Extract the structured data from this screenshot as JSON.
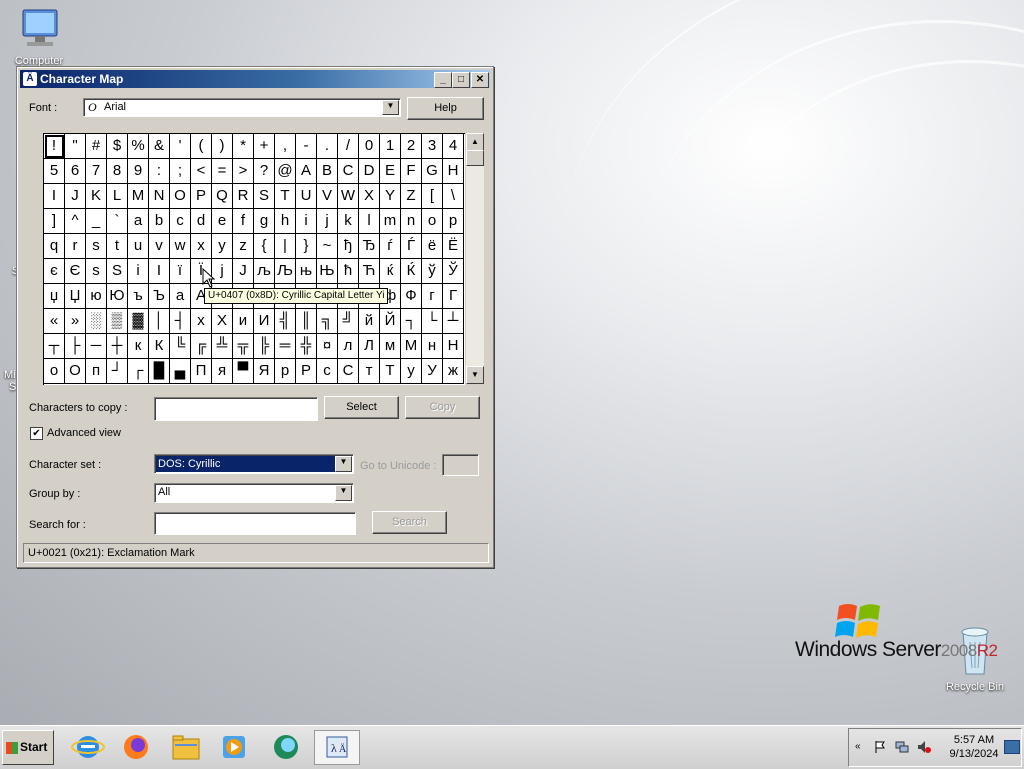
{
  "desktop": {
    "icons": [
      {
        "label": "Computer"
      },
      {
        "label": "Recycle Bin"
      }
    ],
    "edge_fragments": [
      "Mi",
      "S",
      "S"
    ],
    "logo": {
      "brand": "Windows Server",
      "version": "2008",
      "edition": "R2"
    }
  },
  "window": {
    "title": "Character Map",
    "font_label": "Font :",
    "font_value": "Arial",
    "help_label": "Help",
    "grid_rows": [
      [
        "!",
        "\"",
        "#",
        "$",
        "%",
        "&",
        "'",
        "(",
        ")",
        "*",
        "+",
        ",",
        "-",
        ".",
        "/",
        "0",
        "1",
        "2",
        "3",
        "4"
      ],
      [
        "5",
        "6",
        "7",
        "8",
        "9",
        ":",
        ";",
        "<",
        "=",
        ">",
        "?",
        "@",
        "A",
        "B",
        "C",
        "D",
        "E",
        "F",
        "G",
        "H"
      ],
      [
        "I",
        "J",
        "K",
        "L",
        "M",
        "N",
        "O",
        "P",
        "Q",
        "R",
        "S",
        "T",
        "U",
        "V",
        "W",
        "X",
        "Y",
        "Z",
        "[",
        "\\"
      ],
      [
        "]",
        "^",
        "_",
        "`",
        "a",
        "b",
        "c",
        "d",
        "e",
        "f",
        "g",
        "h",
        "i",
        "j",
        "k",
        "l",
        "m",
        "n",
        "o",
        "p"
      ],
      [
        "q",
        "r",
        "s",
        "t",
        "u",
        "v",
        "w",
        "x",
        "y",
        "z",
        "{",
        "|",
        "}",
        "~",
        "ђ",
        "Ђ",
        "ѓ",
        "Ѓ",
        "ё",
        "Ё"
      ],
      [
        "є",
        "Є",
        "ѕ",
        "Ѕ",
        "і",
        "І",
        "ї",
        "Ї",
        "ј",
        "Ј",
        "љ",
        "Љ",
        "њ",
        "Њ",
        "ћ",
        "Ћ",
        "ќ",
        "Ќ",
        "ў",
        "Ў"
      ],
      [
        "џ",
        "Џ",
        "ю",
        "Ю",
        "ъ",
        "Ъ",
        "а",
        "А",
        "б",
        "Б",
        "ц",
        "Ц",
        "д",
        "Д",
        "е",
        "Е",
        "ф",
        "Ф",
        "г",
        "Г"
      ],
      [
        "«",
        "»",
        "░",
        "▒",
        "▓",
        "│",
        "┤",
        "х",
        "Х",
        "и",
        "И",
        "╣",
        "║",
        "╗",
        "╝",
        "й",
        "Й",
        "┐",
        "└",
        "┴"
      ],
      [
        "┬",
        "├",
        "─",
        "┼",
        "к",
        "К",
        "╚",
        "╔",
        "╩",
        "╦",
        "╠",
        "═",
        "╬",
        "¤",
        "л",
        "Л",
        "м",
        "М",
        "н",
        "Н"
      ],
      [
        "о",
        "О",
        "п",
        "┘",
        "┌",
        "█",
        "▄",
        "П",
        "я",
        "▀",
        "Я",
        "р",
        "Р",
        "с",
        "С",
        "т",
        "Т",
        "у",
        "У",
        "ж"
      ]
    ],
    "selected_char": "!",
    "tooltip": "U+0407 (0x8D): Cyrillic Capital Letter Yi",
    "chars_to_copy_label": "Characters to copy :",
    "chars_to_copy_value": "",
    "select_label": "Select",
    "copy_label": "Copy",
    "advanced_view_label": "Advanced view",
    "advanced_view_checked": true,
    "character_set_label": "Character set :",
    "character_set_value": "DOS: Cyrillic",
    "go_to_unicode_label": "Go to Unicode :",
    "group_by_label": "Group by :",
    "group_by_value": "All",
    "search_for_label": "Search for :",
    "search_value": "",
    "search_button_label": "Search",
    "status_text": "U+0021 (0x21): Exclamation Mark"
  },
  "taskbar": {
    "start_label": "Start",
    "apps": [
      "internet-explorer-icon",
      "firefox-icon",
      "file-explorer-icon",
      "media-player-icon",
      "messenger-icon",
      "character-map-icon"
    ],
    "active_app": "character-map-icon",
    "clock_time": "5:57 AM",
    "clock_date": "9/13/2024"
  }
}
